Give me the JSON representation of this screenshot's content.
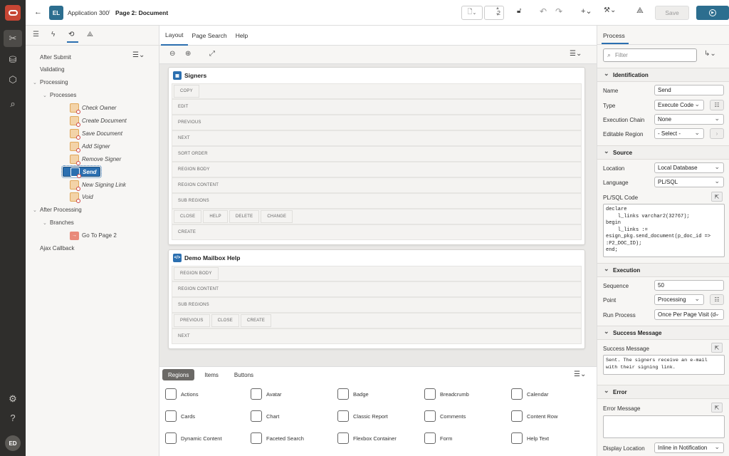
{
  "nav": {
    "avatar": "ED"
  },
  "topbar": {
    "app_badge": "EL",
    "app_name": "Application 300",
    "page_name": "Page 2: Document",
    "page_number": "2",
    "save_label": "Save"
  },
  "tree": {
    "rows": [
      {
        "label": "After Submit",
        "indent": 0,
        "toggle": ""
      },
      {
        "label": "Validating",
        "indent": 0,
        "toggle": ""
      },
      {
        "label": "Processing",
        "indent": 0,
        "toggle": "⌄"
      },
      {
        "label": "Processes",
        "indent": 1,
        "toggle": "⌄"
      },
      {
        "label": "Check Owner",
        "indent": 2,
        "toggle": "",
        "icon": true
      },
      {
        "label": "Create Document",
        "indent": 2,
        "toggle": "",
        "icon": true
      },
      {
        "label": "Save Document",
        "indent": 2,
        "toggle": "",
        "icon": true
      },
      {
        "label": "Add Signer",
        "indent": 2,
        "toggle": "",
        "icon": true
      },
      {
        "label": "Remove Signer",
        "indent": 2,
        "toggle": "",
        "icon": true
      },
      {
        "label": "Send",
        "indent": 2,
        "toggle": "",
        "icon": true,
        "selected": true
      },
      {
        "label": "New Signing Link",
        "indent": 2,
        "toggle": "",
        "icon": true
      },
      {
        "label": "Void",
        "indent": 2,
        "toggle": "",
        "icon": true
      },
      {
        "label": "After Processing",
        "indent": 0,
        "toggle": "⌄"
      },
      {
        "label": "Branches",
        "indent": 1,
        "toggle": "⌄"
      },
      {
        "label": "Go To Page 2",
        "indent": 2,
        "toggle": "",
        "branch": true
      },
      {
        "label": "Ajax Callback",
        "indent": 0,
        "toggle": ""
      }
    ]
  },
  "center": {
    "tabs": [
      "Layout",
      "Page Search",
      "Help"
    ],
    "regions": [
      {
        "title": "Signers",
        "slots": [
          [
            "COPY"
          ],
          [
            "EDIT"
          ],
          [
            "PREVIOUS"
          ],
          [
            "NEXT"
          ],
          [
            "SORT ORDER"
          ],
          [
            "REGION BODY"
          ],
          [
            "REGION CONTENT"
          ],
          [
            "SUB REGIONS"
          ],
          [
            "CLOSE",
            "HELP",
            "DELETE",
            "CHANGE"
          ],
          [
            "CREATE"
          ]
        ]
      },
      {
        "title": "Demo Mailbox Help",
        "slots": [
          [
            "REGION BODY"
          ],
          [
            "REGION CONTENT"
          ],
          [
            "SUB REGIONS"
          ],
          [
            "PREVIOUS",
            "CLOSE",
            "CREATE"
          ],
          [
            "NEXT"
          ]
        ]
      }
    ]
  },
  "gallery": {
    "tabs": [
      "Regions",
      "Items",
      "Buttons"
    ],
    "items": [
      "Actions",
      "Avatar",
      "Badge",
      "Breadcrumb",
      "Calendar",
      "Cards",
      "Chart",
      "Classic Report",
      "Comments",
      "Content Row",
      "Dynamic Content",
      "Faceted Search",
      "Flexbox Container",
      "Form",
      "Help Text"
    ]
  },
  "props": {
    "tab": "Process",
    "filter_placeholder": "Filter",
    "identification": {
      "header": "Identification",
      "name_label": "Name",
      "name_value": "Send",
      "type_label": "Type",
      "type_value": "Execute Code",
      "chain_label": "Execution Chain",
      "chain_value": "None",
      "editable_label": "Editable Region",
      "editable_value": "- Select -"
    },
    "source": {
      "header": "Source",
      "location_label": "Location",
      "location_value": "Local Database",
      "language_label": "Language",
      "language_value": "PL/SQL",
      "code_label": "PL/SQL Code",
      "code": "declare\n    l_links varchar2(32767);\nbegin\n    l_links :=\nesign_pkg.send_document(p_doc_id =>\n:P2_DOC_ID);\nend;"
    },
    "execution": {
      "header": "Execution",
      "sequence_label": "Sequence",
      "sequence_value": "50",
      "point_label": "Point",
      "point_value": "Processing",
      "run_label": "Run Process",
      "run_value": "Once Per Page Visit (d"
    },
    "success": {
      "header": "Success Message",
      "label": "Success Message",
      "value": "Sent. The signers receive an e-mail\nwith their signing link."
    },
    "error": {
      "header": "Error",
      "label": "Error Message",
      "display_label": "Display Location",
      "display_value": "Inline in Notification"
    }
  }
}
